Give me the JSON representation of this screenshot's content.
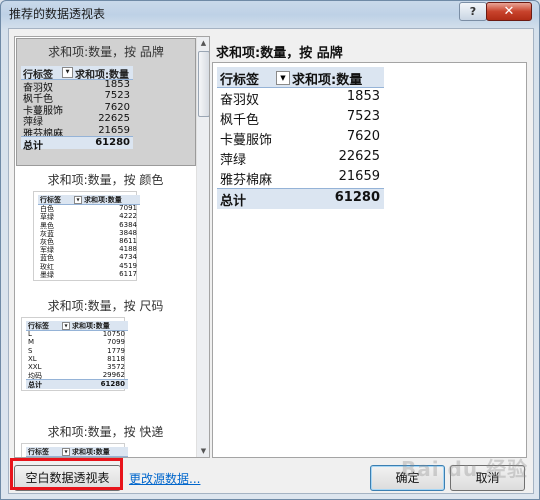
{
  "window": {
    "title": "推荐的数据透视表",
    "help_label": "?",
    "close_label": "✕"
  },
  "list": {
    "cards": [
      {
        "title": "求和项:数量，按 品牌",
        "header": [
          "行标签",
          "求和项:数量"
        ],
        "rows": [
          [
            "奋羽奴",
            "1853"
          ],
          [
            "枫千色",
            "7523"
          ],
          [
            "卡蔓服饰",
            "7620"
          ],
          [
            "萍绿",
            "22625"
          ],
          [
            "雅芬棉麻",
            "21659"
          ]
        ],
        "total": [
          "总计",
          "61280"
        ]
      },
      {
        "title": "求和项:数量，按 颜色",
        "header": [
          "行标签",
          "求和项:数量"
        ],
        "rows": [
          [
            "白色",
            "7091"
          ],
          [
            "草绿",
            "4222"
          ],
          [
            "黑色",
            "6384"
          ],
          [
            "灰蓝",
            "3848"
          ],
          [
            "灰色",
            "8611"
          ],
          [
            "军绿",
            "4188"
          ],
          [
            "蓝色",
            "4734"
          ],
          [
            "玫红",
            "4519"
          ],
          [
            "墨绿",
            "6117"
          ]
        ],
        "total": null
      },
      {
        "title": "求和项:数量，按 尺码",
        "header": [
          "行标签",
          "求和项:数量"
        ],
        "rows": [
          [
            "L",
            "10750"
          ],
          [
            "M",
            "7099"
          ],
          [
            "S",
            "1779"
          ],
          [
            "XL",
            "8118"
          ],
          [
            "XXL",
            "3572"
          ],
          [
            "均码",
            "29962"
          ]
        ],
        "total": [
          "总计",
          "61280"
        ]
      },
      {
        "title": "求和项:数量，按 快递",
        "header": [
          "行标签",
          "求和项:数量"
        ],
        "rows": [],
        "total": null
      }
    ]
  },
  "preview": {
    "title": "求和项:数量，按 品牌",
    "header": [
      "行标签",
      "求和项:数量"
    ],
    "rows": [
      [
        "奋羽奴",
        "1853"
      ],
      [
        "枫千色",
        "7523"
      ],
      [
        "卡蔓服饰",
        "7620"
      ],
      [
        "萍绿",
        "22625"
      ],
      [
        "雅芬棉麻",
        "21659"
      ]
    ],
    "total": [
      "总计",
      "61280"
    ]
  },
  "footer": {
    "blank_pivot_label": "空白数据透视表",
    "change_source_label": "更改源数据...",
    "ok_label": "确定",
    "cancel_label": "取消"
  },
  "watermark": "Bai du 经验"
}
